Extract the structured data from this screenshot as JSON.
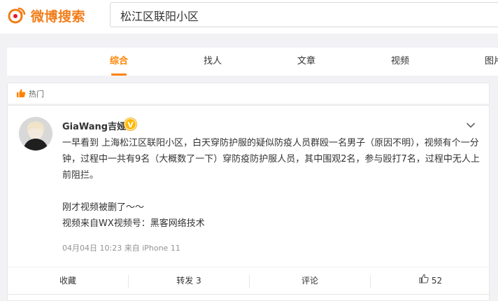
{
  "header": {
    "logo_text": "微博搜索",
    "search_value": "松江区联阳小区"
  },
  "tabs": [
    {
      "label": "综合",
      "active": true
    },
    {
      "label": "找人",
      "active": false
    },
    {
      "label": "文章",
      "active": false
    },
    {
      "label": "视频",
      "active": false
    },
    {
      "label": "图片",
      "active": false
    }
  ],
  "section": {
    "hot_label": "热门"
  },
  "post": {
    "username": "GiaWang吉娅",
    "verified_badge": "V",
    "paragraph1": "一早看到 上海松江区联阳小区，白天穿防护服的疑似防疫人员群殴一名男子（原因不明），视频有个一分钟，过程中一共有9名（大概数了一下）穿防疫防护服人员，其中围观2名，参与殴打7名，过程中无人上前阻拦。",
    "paragraph2": "刚才视频被删了～～",
    "paragraph3": "视频来自WX视频号：黑客网络技术",
    "time": "04月04日 10:23",
    "source": "来自 iPhone 11"
  },
  "actions": {
    "favorite": "收藏",
    "repost": "转发 3",
    "comment": "评论",
    "like_count": "52"
  },
  "colors": {
    "accent": "#ff8200",
    "logo": "#f27d19",
    "badge": "#ffb800",
    "background": "#f2f2f5"
  }
}
